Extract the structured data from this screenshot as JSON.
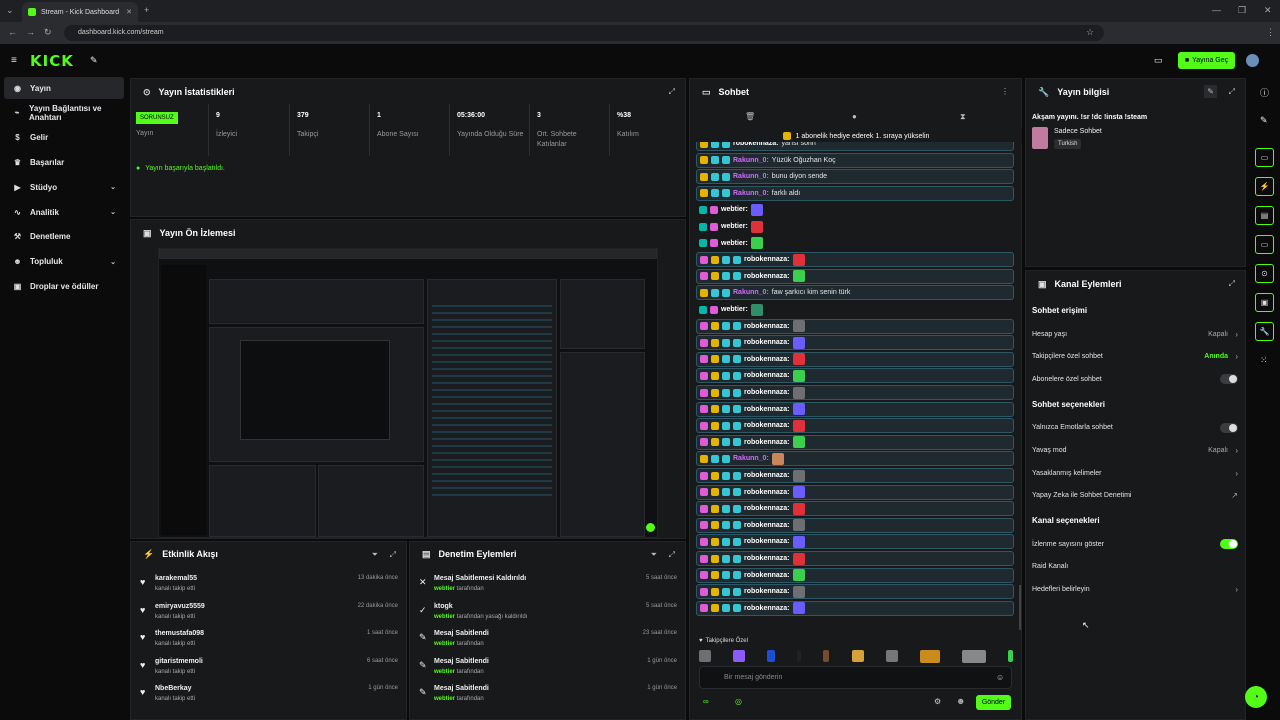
{
  "browser": {
    "tab_title": "Stream - Kick Dashboard",
    "new_tab": "+",
    "url": "dashboard.kick.com/stream"
  },
  "header": {
    "logo": "KICK",
    "go_live_label": "Yayına Geç"
  },
  "sidebar": {
    "items": [
      {
        "label": "Yayın",
        "icon": "broadcast-icon",
        "active": true
      },
      {
        "label": "Yayın Bağlantısı ve Anahtarı",
        "icon": "link-icon"
      },
      {
        "label": "Gelir",
        "icon": "dollar-icon"
      },
      {
        "label": "Başarılar",
        "icon": "trophy-icon"
      },
      {
        "label": "Stüdyo",
        "icon": "video-icon",
        "chevron": true
      },
      {
        "label": "Analitik",
        "icon": "chart-icon",
        "chevron": true
      },
      {
        "label": "Denetleme",
        "icon": "hammer-icon"
      },
      {
        "label": "Topluluk",
        "icon": "people-icon",
        "chevron": true
      },
      {
        "label": "Droplar ve ödüller",
        "icon": "gift-icon"
      }
    ]
  },
  "stats": {
    "title": "Yayın İstatistikleri",
    "status_badge": "SORUNSUZ",
    "status_label": "Yayın",
    "items": [
      {
        "value": "9",
        "label": "İzleyici"
      },
      {
        "value": "379",
        "label": "Takipçi"
      },
      {
        "value": "1",
        "label": "Abone Sayısı"
      },
      {
        "value": "05:36:00",
        "label": "Yayında Olduğu Süre"
      },
      {
        "value": "3",
        "label": "Ort. Sohbete Katılanlar"
      },
      {
        "value": "%38",
        "label": "Katılım"
      }
    ],
    "success_message": "Yayın başarıyla başlatıldı."
  },
  "preview": {
    "title": "Yayın Ön İzlemesi"
  },
  "activity": {
    "title": "Etkinlik Akışı",
    "items": [
      {
        "name": "karakemal55",
        "sub": "kanalı takip etti",
        "time": "13 dakika önce"
      },
      {
        "name": "emiryavuz5559",
        "sub": "kanalı takip etti",
        "time": "22 dakika önce"
      },
      {
        "name": "themustafa098",
        "sub": "kanalı takip etti",
        "time": "1 saat önce"
      },
      {
        "name": "gitaristmemoli",
        "sub": "kanalı takip etti",
        "time": "6 saat önce"
      },
      {
        "name": "NbeBerkay",
        "sub": "kanalı takip etti",
        "time": "1 gün önce"
      }
    ]
  },
  "moderation": {
    "title": "Denetim Eylemleri",
    "items": [
      {
        "action": "Mesaj Sabitlemesi Kaldırıldı",
        "by": "webtier",
        "suffix": " tarafından",
        "time": "5 saat önce",
        "icon": "unpin-icon"
      },
      {
        "action": "ktogk",
        "by": "webtier",
        "suffix": " tarafından yasağı kaldırıldı",
        "time": "5 saat önce",
        "icon": "unban-icon"
      },
      {
        "action": "Mesaj Sabitlendi",
        "by": "webtier",
        "suffix": " tarafından",
        "time": "23 saat önce",
        "icon": "pin-icon"
      },
      {
        "action": "Mesaj Sabitlendi",
        "by": "webtier",
        "suffix": " tarafından",
        "time": "1 gün önce",
        "icon": "pin-icon"
      },
      {
        "action": "Mesaj Sabitlendi",
        "by": "webtier",
        "suffix": " tarafından",
        "time": "1 gün önce",
        "icon": "pin-icon"
      }
    ]
  },
  "chat": {
    "title": "Sohbet",
    "notice": "1 abonelik hediye ederek 1. sıraya yükselin",
    "messages": [
      {
        "user": "robokennaza:",
        "color": "#ffffff",
        "text": "yarısı sorin",
        "badges": [
          "y",
          "c",
          "c"
        ]
      },
      {
        "user": "Rakunn_0:",
        "color": "#d46bff",
        "text": "Yüzük Oğuzhan Koç",
        "badges": [
          "y",
          "c",
          "c"
        ]
      },
      {
        "user": "Rakunn_0:",
        "color": "#d46bff",
        "text": "bunu diyon sende",
        "badges": [
          "y",
          "c",
          "c"
        ]
      },
      {
        "user": "Rakunn_0:",
        "color": "#d46bff",
        "text": "farklı aldı",
        "badges": [
          "y",
          "c",
          "c"
        ]
      },
      {
        "user": "webtier:",
        "color": "#ffffff",
        "text": "",
        "badges": [
          "t",
          "p"
        ],
        "emote": "#6b5cff"
      },
      {
        "user": "webtier:",
        "color": "#ffffff",
        "text": "",
        "badges": [
          "t",
          "p"
        ],
        "emote": "#e0303a"
      },
      {
        "user": "webtier:",
        "color": "#ffffff",
        "text": "",
        "badges": [
          "t",
          "p"
        ],
        "emote": "#3ccf4e"
      },
      {
        "user": "robokennaza:",
        "color": "#ffffff",
        "text": "",
        "badges": [
          "p",
          "y",
          "c",
          "c"
        ],
        "emote": "#e0303a"
      },
      {
        "user": "robokennaza:",
        "color": "#ffffff",
        "text": "",
        "badges": [
          "p",
          "y",
          "c",
          "c"
        ],
        "emote": "#3ccf4e"
      },
      {
        "user": "Rakunn_0:",
        "color": "#d46bff",
        "text": "faw şarkıcı kim senin türk",
        "badges": [
          "y",
          "c",
          "c"
        ]
      },
      {
        "user": "webtier:",
        "color": "#ffffff",
        "text": "",
        "badges": [
          "t",
          "p"
        ],
        "emote": "#2f8f6a"
      },
      {
        "user": "robokennaza:",
        "color": "#ffffff",
        "text": "",
        "badges": [
          "p",
          "y",
          "c",
          "c"
        ],
        "emote": "#6d6f73"
      },
      {
        "user": "robokennaza:",
        "color": "#ffffff",
        "text": "",
        "badges": [
          "p",
          "y",
          "c",
          "c"
        ],
        "emote": "#6b5cff"
      },
      {
        "user": "robokennaza:",
        "color": "#ffffff",
        "text": "",
        "badges": [
          "p",
          "y",
          "c",
          "c"
        ],
        "emote": "#e0303a"
      },
      {
        "user": "robokennaza:",
        "color": "#ffffff",
        "text": "",
        "badges": [
          "p",
          "y",
          "c",
          "c"
        ],
        "emote": "#3ccf4e"
      },
      {
        "user": "robokennaza:",
        "color": "#ffffff",
        "text": "",
        "badges": [
          "p",
          "y",
          "c",
          "c"
        ],
        "emote": "#6d6f73"
      },
      {
        "user": "robokennaza:",
        "color": "#ffffff",
        "text": "",
        "badges": [
          "p",
          "y",
          "c",
          "c"
        ],
        "emote": "#6b5cff"
      },
      {
        "user": "robokennaza:",
        "color": "#ffffff",
        "text": "",
        "badges": [
          "p",
          "y",
          "c",
          "c"
        ],
        "emote": "#e0303a"
      },
      {
        "user": "robokennaza:",
        "color": "#ffffff",
        "text": "",
        "badges": [
          "p",
          "y",
          "c",
          "c"
        ],
        "emote": "#3ccf4e"
      },
      {
        "user": "Rakunn_0:",
        "color": "#d46bff",
        "text": "",
        "badges": [
          "y",
          "c",
          "c"
        ],
        "emote": "#c8865a"
      },
      {
        "user": "robokennaza:",
        "color": "#ffffff",
        "text": "",
        "badges": [
          "p",
          "y",
          "c",
          "c"
        ],
        "emote": "#6d6f73"
      },
      {
        "user": "robokennaza:",
        "color": "#ffffff",
        "text": "",
        "badges": [
          "p",
          "y",
          "c",
          "c"
        ],
        "emote": "#6b5cff"
      },
      {
        "user": "robokennaza:",
        "color": "#ffffff",
        "text": "",
        "badges": [
          "p",
          "y",
          "c",
          "c"
        ],
        "emote": "#e0303a"
      },
      {
        "user": "robokennaza:",
        "color": "#ffffff",
        "text": "",
        "badges": [
          "p",
          "y",
          "c",
          "c"
        ],
        "emote": "#6d6f73"
      },
      {
        "user": "robokennaza:",
        "color": "#ffffff",
        "text": "",
        "badges": [
          "p",
          "y",
          "c",
          "c"
        ],
        "emote": "#6b5cff"
      },
      {
        "user": "robokennaza:",
        "color": "#ffffff",
        "text": "",
        "badges": [
          "p",
          "y",
          "c",
          "c"
        ],
        "emote": "#e0303a"
      },
      {
        "user": "robokennaza:",
        "color": "#ffffff",
        "text": "",
        "badges": [
          "p",
          "y",
          "c",
          "c"
        ],
        "emote": "#3ccf4e"
      },
      {
        "user": "robokennaza:",
        "color": "#ffffff",
        "text": "",
        "badges": [
          "p",
          "y",
          "c",
          "c"
        ],
        "emote": "#6d6f73"
      },
      {
        "user": "robokennaza:",
        "color": "#ffffff",
        "text": "",
        "badges": [
          "p",
          "y",
          "c",
          "c"
        ],
        "emote": "#6b5cff"
      }
    ],
    "followers_only": "Takipçilere Özel",
    "input_placeholder": "Bir mesaj gönderin",
    "send_label": "Gönder"
  },
  "stream_info": {
    "title": "Yayın bilgisi",
    "stream_title": "Akşam yayını. !sr !dc !insta !steam",
    "category": "Sadece Sohbet",
    "language": "Turkish"
  },
  "channel_actions": {
    "title": "Kanal Eylemleri",
    "sections": [
      {
        "heading": "Sohbet erişimi",
        "rows": [
          {
            "label": "Hesap yaşı",
            "value": "Kapalı",
            "kind": "arrow"
          },
          {
            "label": "Takipçilere özel sohbet",
            "value": "Anında",
            "kind": "arrow",
            "accent": true
          },
          {
            "label": "Abonelere özel sohbet",
            "value": "",
            "kind": "toggle-off"
          }
        ]
      },
      {
        "heading": "Sohbet seçenekleri",
        "rows": [
          {
            "label": "Yalnızca Emotlarla sohbet",
            "value": "",
            "kind": "toggle-off"
          },
          {
            "label": "Yavaş mod",
            "value": "Kapalı",
            "kind": "arrow"
          },
          {
            "label": "Yasaklanmış kelimeler",
            "value": "",
            "kind": "arrow"
          },
          {
            "label": "Yapay Zeka ile Sohbet Denetimi",
            "value": "",
            "kind": "external"
          }
        ]
      },
      {
        "heading": "Kanal seçenekleri",
        "rows": [
          {
            "label": "İzlenme sayısını göster",
            "value": "",
            "kind": "toggle-on"
          },
          {
            "label": "Raid Kanalı",
            "value": "",
            "kind": "none"
          },
          {
            "label": "Hedefleri belirleyin",
            "value": "",
            "kind": "arrow"
          }
        ]
      }
    ]
  },
  "colors": {
    "accent": "#53fc18",
    "panel": "#18191b",
    "bg": "#0b0b0c"
  }
}
